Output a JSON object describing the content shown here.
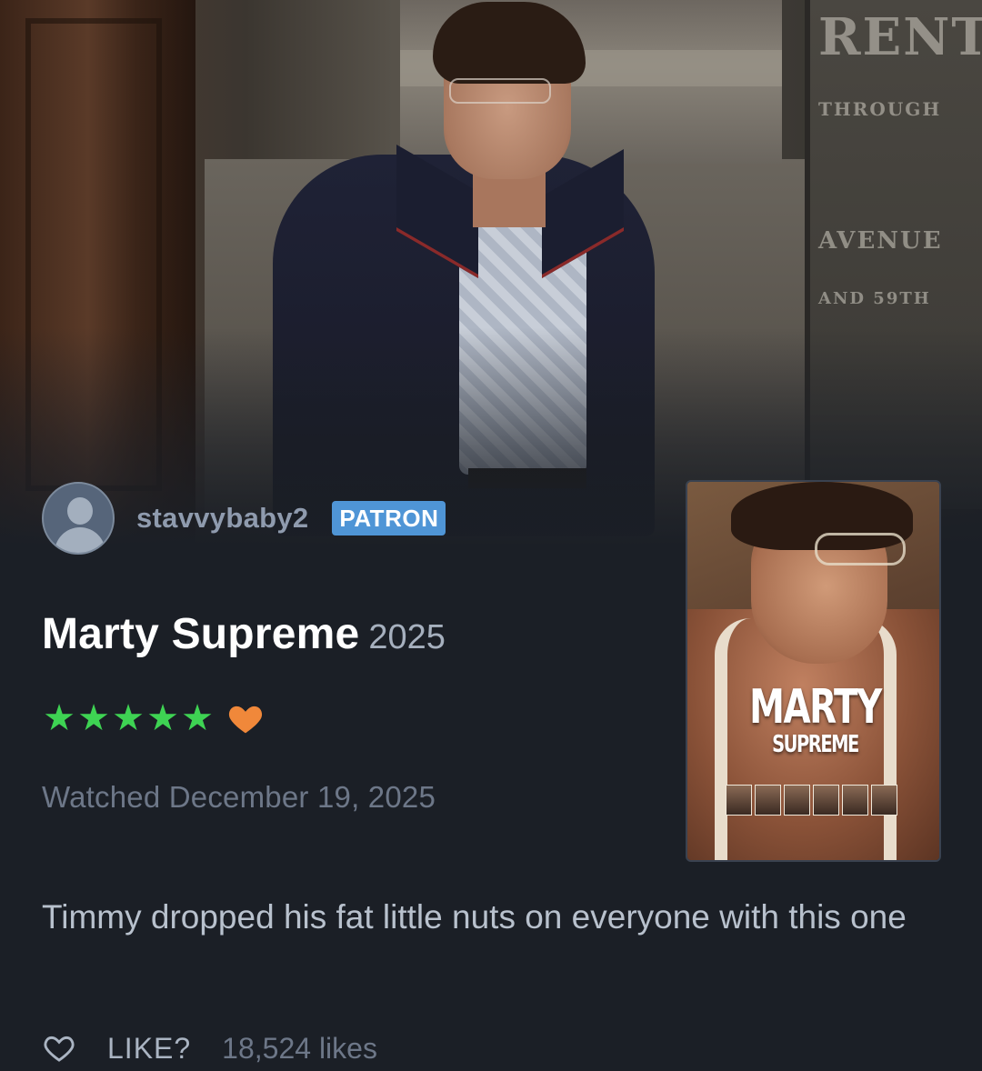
{
  "review": {
    "username": "stavvybaby2",
    "badge": "PATRON",
    "film_title": "Marty Supreme",
    "film_year": "2025",
    "rating_stars": 5,
    "liked": true,
    "watched_text": "Watched December 19, 2025",
    "body": "Timmy dropped his fat little nuts on everyone with this one",
    "like_label": "LIKE?",
    "likes_count": "18,524 likes"
  },
  "poster": {
    "title_line1": "MARTY",
    "title_line2": "SUPREME"
  },
  "backdrop": {
    "plaque_lines": [
      "RENT",
      "THROUGH",
      "AVENUE",
      "AND 59TH"
    ]
  },
  "colors": {
    "background": "#1b1f26",
    "star_green": "#3ed353",
    "heart_orange": "#f0883a",
    "patron_blue": "#4f95d6",
    "username_gray": "#8f9bae"
  },
  "icons": {
    "avatar": "default-user-avatar-icon",
    "rating": "star-icon",
    "liked": "filled-heart-icon",
    "like_action": "outline-heart-icon"
  }
}
